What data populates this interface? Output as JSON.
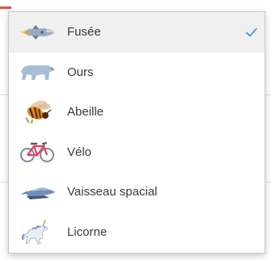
{
  "dropdown": {
    "selected_index": 0,
    "items": [
      {
        "label": "Fusée",
        "icon": "rocket-icon"
      },
      {
        "label": "Ours",
        "icon": "bear-icon"
      },
      {
        "label": "Abeille",
        "icon": "bee-icon"
      },
      {
        "label": "Vélo",
        "icon": "bicycle-icon"
      },
      {
        "label": "Vaisseau spacial",
        "icon": "spaceship-icon"
      },
      {
        "label": "Licorne",
        "icon": "unicorn-icon"
      }
    ]
  },
  "colors": {
    "accent_check": "#5b9bd5",
    "menu_border": "#c8c8c8",
    "selected_bg": "#f0f0f0",
    "text": "#3a3a3a"
  }
}
